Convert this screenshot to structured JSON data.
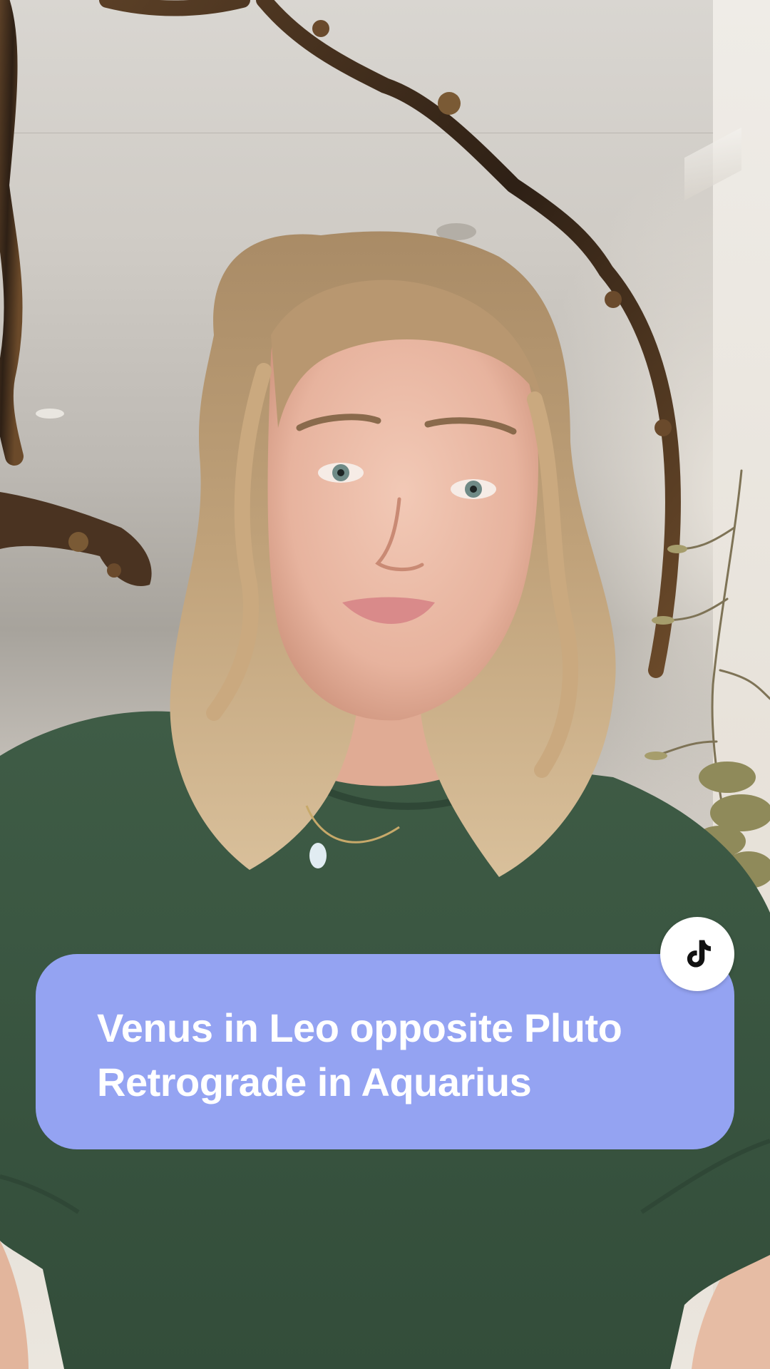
{
  "caption": {
    "line1": "Venus in Leo opposite Pluto",
    "line2": "Retrograde in Aquarius",
    "background_color": "#94a3f2",
    "text_color": "#ffffff"
  },
  "badge": {
    "icon": "tiktok-logo-icon",
    "background_color": "#ffffff",
    "icon_color": "#111111"
  },
  "scene": {
    "subject_shirt_color": "#3e5a45",
    "subject_hair_color": "#b99b74",
    "mirror_frame_color": "#3b2a1c"
  }
}
